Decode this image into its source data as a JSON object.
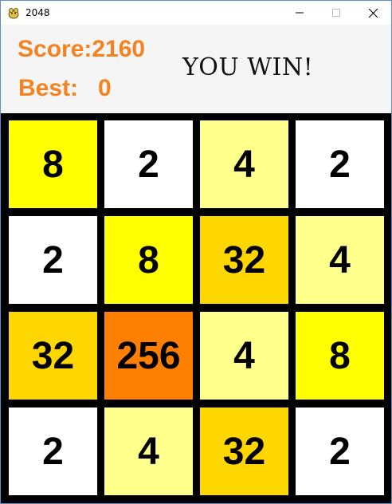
{
  "window": {
    "title": "2048"
  },
  "header": {
    "score_text": "Score:2160",
    "best_text": "Best:   0",
    "status": "YOU WIN!"
  },
  "colors": {
    "accent": "#f58220",
    "tile_2": "#ffffff",
    "tile_4": "#ffff8c",
    "tile_8": "#ffff00",
    "tile_32": "#ffd700",
    "tile_256": "#ff8000",
    "board": "#000000"
  },
  "board": {
    "rows": [
      [
        "8",
        "2",
        "4",
        "2"
      ],
      [
        "2",
        "8",
        "32",
        "4"
      ],
      [
        "32",
        "256",
        "4",
        "8"
      ],
      [
        "2",
        "4",
        "32",
        "2"
      ]
    ]
  }
}
